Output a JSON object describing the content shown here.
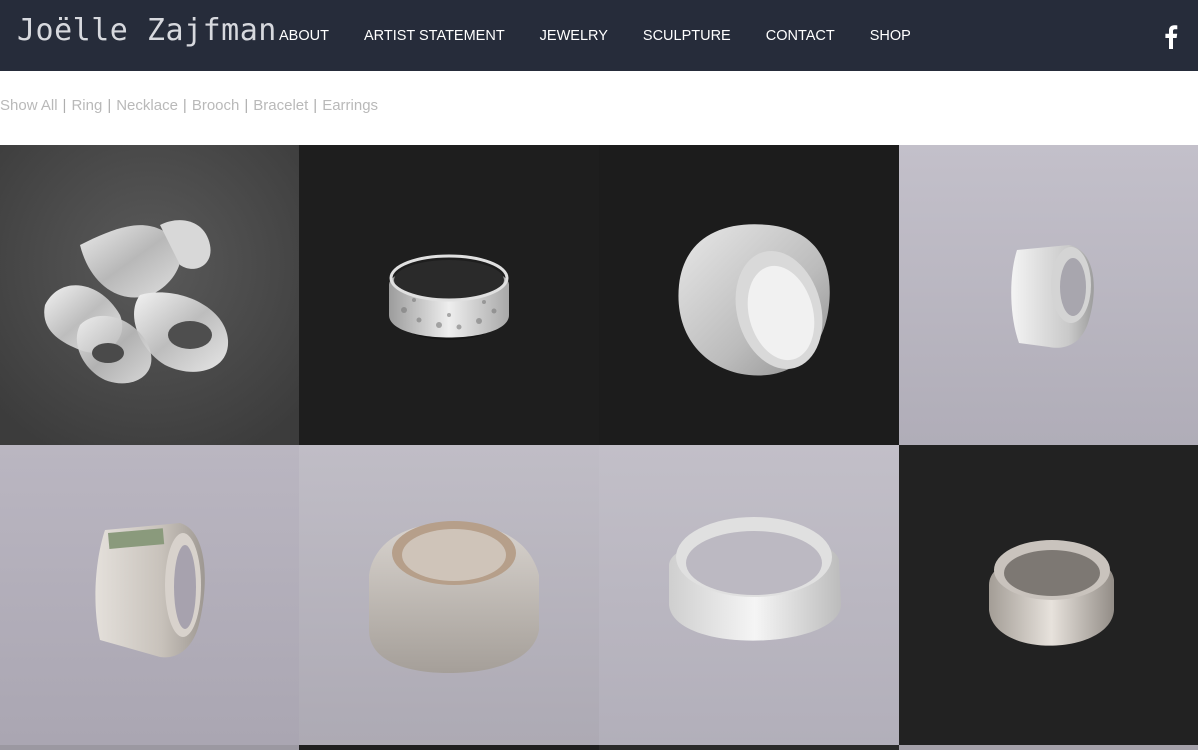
{
  "site": {
    "logo": "Joëlle Zajfman"
  },
  "nav": {
    "items": [
      {
        "label": "ABOUT"
      },
      {
        "label": "ARTIST STATEMENT"
      },
      {
        "label": "JEWELRY"
      },
      {
        "label": "SCULPTURE"
      },
      {
        "label": "CONTACT"
      },
      {
        "label": "SHOP"
      }
    ],
    "social_icon": "facebook-icon"
  },
  "filters": {
    "items": [
      {
        "label": "Show All"
      },
      {
        "label": "Ring"
      },
      {
        "label": "Necklace"
      },
      {
        "label": "Brooch"
      },
      {
        "label": "Bracelet"
      },
      {
        "label": "Earrings"
      }
    ],
    "separator": "|"
  },
  "colors": {
    "header_bg": "#262c3a",
    "filter_text": "#b9b9b9"
  },
  "gallery": {
    "tiles": [
      {
        "name": "ring-cluster-photo",
        "bg": "#4a4a4a"
      },
      {
        "name": "textured-band-ring-photo",
        "bg": "#1e1e1e"
      },
      {
        "name": "wide-square-ring-photo",
        "bg": "#1c1c1c"
      },
      {
        "name": "narrow-signet-ring-photo",
        "bg": "#b9b6c0"
      },
      {
        "name": "ring-with-stone-photo",
        "bg": "#b4b0bb"
      },
      {
        "name": "matte-signet-ring-photo",
        "bg": "#b7b4bd"
      },
      {
        "name": "polished-band-ring-photo",
        "bg": "#bbb8c2"
      },
      {
        "name": "dome-ring-photo",
        "bg": "#222222"
      }
    ]
  }
}
